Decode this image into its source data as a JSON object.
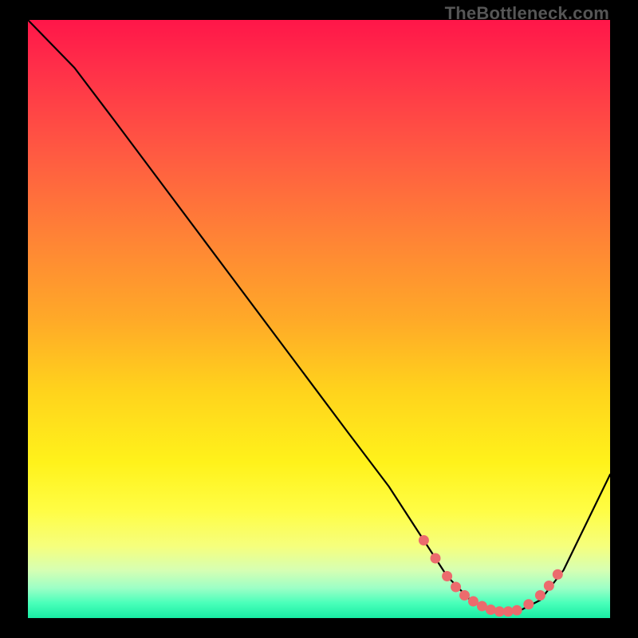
{
  "watermark": "TheBottleneck.com",
  "colors": {
    "curve_stroke": "#000000",
    "dot_fill": "#ec6b6d",
    "gradient_top": "#ff1649",
    "gradient_bottom": "#18eca3"
  },
  "chart_data": {
    "type": "line",
    "title": "",
    "xlabel": "",
    "ylabel": "",
    "xlim": [
      0,
      100
    ],
    "ylim": [
      0,
      100
    ],
    "grid": false,
    "legend": false,
    "series": [
      {
        "name": "bottleneck-curve",
        "x": [
          0,
          4,
          8,
          15,
          25,
          35,
          45,
          55,
          62,
          68,
          72,
          76,
          80,
          84,
          88,
          92,
          100
        ],
        "y": [
          100,
          96,
          92,
          83,
          70,
          57,
          44,
          31,
          22,
          13,
          7,
          3,
          1,
          1,
          3,
          8,
          24
        ]
      }
    ],
    "dots": {
      "name": "highlighted-range",
      "x": [
        68,
        70,
        72,
        73.5,
        75,
        76.5,
        78,
        79.5,
        81,
        82.5,
        84,
        86,
        88,
        89.5,
        91
      ],
      "y": [
        13,
        10,
        7,
        5.2,
        3.8,
        2.8,
        2.0,
        1.4,
        1.1,
        1.1,
        1.3,
        2.3,
        3.8,
        5.4,
        7.3
      ]
    }
  }
}
